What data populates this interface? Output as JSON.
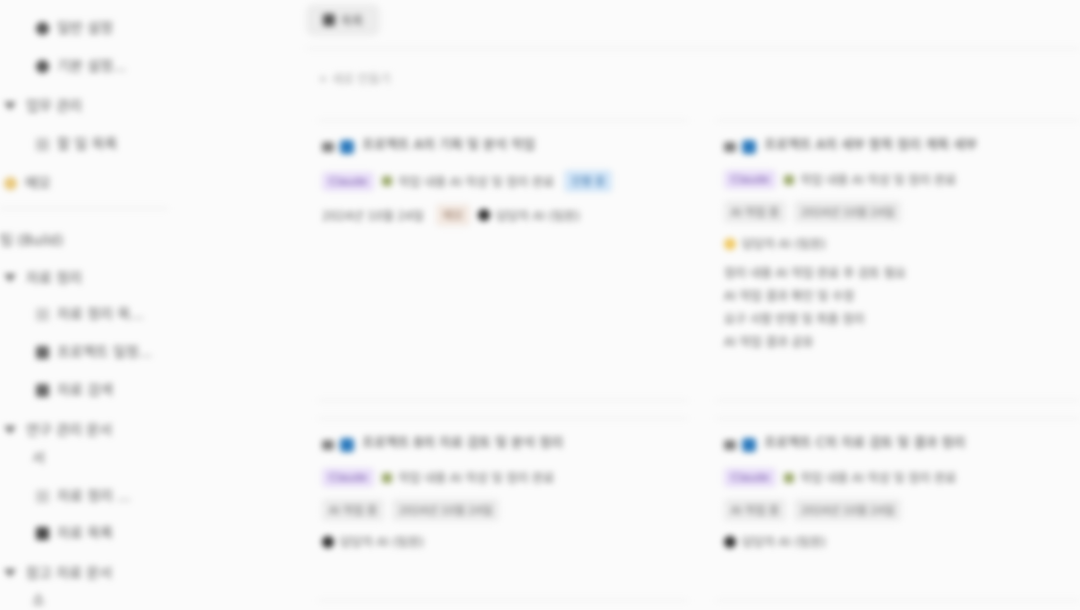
{
  "sidebar": {
    "items": [
      {
        "label": "일반 설정",
        "level": 2,
        "icon": "gear-icon"
      },
      {
        "label": "기본 설정...",
        "level": 2,
        "icon": "gear-icon"
      },
      {
        "label": "업무 관리",
        "level": 1,
        "icon": "toggle-open-icon"
      },
      {
        "label": "할 일 목록",
        "level": 2,
        "icon": "pencil-icon"
      },
      {
        "label": "메모",
        "level": 0,
        "icon": "yellow-page-icon"
      },
      {
        "label": "팀 (Build)",
        "level": 0,
        "icon": "none"
      },
      {
        "label": "자료 정리",
        "level": 1,
        "icon": "toggle-open-icon"
      },
      {
        "label": "자료 정리 목...",
        "level": 2,
        "icon": "page-icon"
      },
      {
        "label": "프로젝트 일정...",
        "level": 2,
        "icon": "book-icon"
      },
      {
        "label": "자료 검색",
        "level": 2,
        "icon": "book-icon"
      },
      {
        "label": "연구 관리 문서",
        "level": 1,
        "icon": "toggle-open-icon"
      },
      {
        "label": "서",
        "level": 1,
        "icon": "none"
      },
      {
        "label": "자료 정리 ...",
        "level": 2,
        "icon": "page-icon"
      },
      {
        "label": "자료 목록",
        "level": 2,
        "icon": "book-icon"
      },
      {
        "label": "참고 자료 문서",
        "level": 1,
        "icon": "toggle-open-icon"
      },
      {
        "label": "소",
        "level": 1,
        "icon": "none"
      }
    ]
  },
  "toolbar": {
    "view_label": "목록"
  },
  "main": {
    "new_page_label": "+ 새로 만들기",
    "cards": [
      {
        "title": "프로젝트 A의 기획 및 분석 작업",
        "tags": [
          {
            "text": "Claude",
            "style": "purple"
          },
          {
            "text": "작업 내용 AI 작성 및 정리 완료",
            "style": "plain-green"
          },
          {
            "text": "진행 중",
            "style": "blue"
          }
        ],
        "meta": [
          {
            "text": "2024년 10월 24일",
            "style": "plain"
          },
          {
            "text": "메모",
            "style": "tan"
          }
        ],
        "owner": "담당자 AI (팀원)",
        "owner_dot": "dark",
        "description": []
      },
      {
        "title": "프로젝트 A의 세부 항목 정리 계획 세부",
        "tags": [
          {
            "text": "Claude",
            "style": "purple"
          },
          {
            "text": "작업 내용 AI 작성 및 정리 완료",
            "style": "plain-green"
          }
        ],
        "meta": [
          {
            "text": "AI 작업 중",
            "style": "gray"
          },
          {
            "text": "2024년 10월 24일",
            "style": "gray"
          }
        ],
        "owner": "담당자 AI (팀원)",
        "owner_dot": "yellow",
        "description": [
          "정리 내용 AI 작업 완료 후 검토 필요",
          "AI 작업 결과 확인 및 수정",
          "요구 사항 반영 및 최종 정리",
          "AI 작업 결과 공유"
        ]
      },
      {
        "title": "프로젝트 B의 자료 검토 및 분석 정리",
        "tags": [
          {
            "text": "Claude",
            "style": "purple"
          },
          {
            "text": "작업 내용 AI 작성 및 정리 완료",
            "style": "plain-green"
          }
        ],
        "meta": [
          {
            "text": "AI 작업 중",
            "style": "gray"
          },
          {
            "text": "2024년 10월 24일",
            "style": "gray"
          }
        ],
        "owner": "담당자 AI (팀원)",
        "owner_dot": "dark",
        "description": []
      },
      {
        "title": "프로젝트 C의 자료 검토 및 결과 정리",
        "tags": [
          {
            "text": "Claude",
            "style": "purple"
          },
          {
            "text": "작업 내용 AI 작성 및 정리 완료",
            "style": "plain-green"
          }
        ],
        "meta": [
          {
            "text": "AI 작업 중",
            "style": "gray"
          },
          {
            "text": "2024년 10월 24일",
            "style": "gray"
          }
        ],
        "owner": "담당자 AI (팀원)",
        "owner_dot": "dark",
        "description": []
      }
    ]
  }
}
